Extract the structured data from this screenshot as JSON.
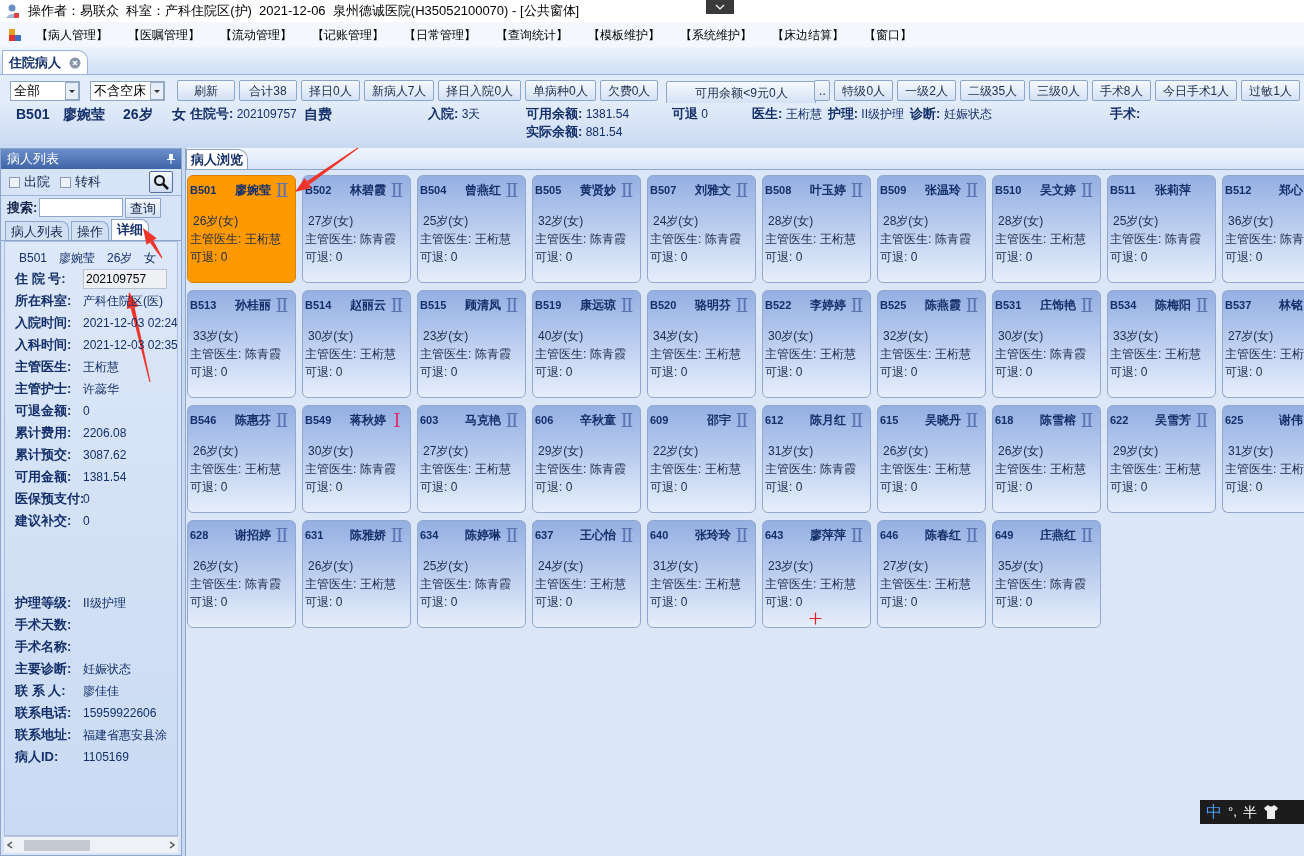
{
  "window": {
    "title": "操作者：易联众  科室：产科住院区(护)  2021-12-06  泉州德诚医院(H35052100070) - [公共窗体]"
  },
  "menu": [
    "【病人管理】",
    "【医嘱管理】",
    "【流动管理】",
    "【记账管理】",
    "【日常管理】",
    "【查询统计】",
    "【模板维护】",
    "【系统维护】",
    "【床边结算】",
    "【窗口】"
  ],
  "doc_tabs": [
    {
      "label": "住院病人",
      "selected": true
    }
  ],
  "toolbar": {
    "filters": [
      "全部",
      "不含空床"
    ],
    "buttons": [
      {
        "label": "刷新",
        "kind": "plain"
      },
      {
        "label": "合计38",
        "kind": "plain"
      },
      {
        "label": "择日0人",
        "kind": "plain"
      },
      {
        "label": "新病人7人",
        "kind": "plain"
      },
      {
        "label": "择日入院0人",
        "kind": "plain"
      },
      {
        "label": "单病种0人",
        "kind": "plain"
      },
      {
        "label": "欠费0人",
        "kind": "plain"
      },
      {
        "label": "可用余额<9元0人",
        "kind": "wide"
      },
      {
        "label": "..",
        "kind": "more"
      },
      {
        "label": "特级0人",
        "kind": "plain"
      },
      {
        "label": "一级2人",
        "kind": "plain"
      },
      {
        "label": "二级35人",
        "kind": "plain"
      },
      {
        "label": "三级0人",
        "kind": "plain"
      },
      {
        "label": "手术8人",
        "kind": "plain"
      },
      {
        "label": "今日手术1人",
        "kind": "plain"
      },
      {
        "label": "过敏1人",
        "kind": "plain"
      }
    ]
  },
  "summary": {
    "row_1": [
      {
        "kind": "big",
        "value": "B501"
      },
      {
        "kind": "big",
        "value": "廖婉莹"
      },
      {
        "kind": "big",
        "value": "26岁"
      },
      {
        "kind": "big",
        "value": "女"
      },
      {
        "kind": "field",
        "label": "住院号:",
        "value": "202109757"
      },
      {
        "kind": "big",
        "value": "自费"
      },
      {
        "kind": "field",
        "label": "入院:",
        "value": "3天"
      },
      {
        "kind": "field",
        "label": "可用余额:",
        "value": "1381.54"
      },
      {
        "kind": "field",
        "label": "可退",
        "value": "0"
      },
      {
        "kind": "field",
        "label": "医生:",
        "value": "王桁慧"
      },
      {
        "kind": "field",
        "label": "护理:",
        "value": "II级护理"
      },
      {
        "kind": "field",
        "label": "诊断:",
        "value": "妊娠状态"
      },
      {
        "kind": "field",
        "label": "手术:"
      }
    ],
    "row_2": [
      {
        "kind": "field",
        "label": "实际余额:",
        "value": "881.54"
      }
    ]
  },
  "sidebar": {
    "title": "病人列表",
    "checkboxes": [
      {
        "label": "出院",
        "checked": false
      },
      {
        "label": "转科",
        "checked": false
      }
    ],
    "search": {
      "label": "搜索:",
      "button": "查询"
    },
    "tabs": [
      {
        "label": "病人列表",
        "selected": false
      },
      {
        "label": "操作",
        "selected": false
      },
      {
        "label": "详细",
        "selected": true
      }
    ],
    "heading": [
      "B501",
      "廖婉莹",
      "26岁",
      "女"
    ],
    "sections": [
      [
        {
          "label": "住 院 号:",
          "value": "202109757",
          "kind": "input"
        },
        {
          "label": "所在科室:",
          "value": "产科住院区(医)"
        },
        {
          "label": "入院时间:",
          "value": "2021-12-03 02:24"
        },
        {
          "label": "入科时间:",
          "value": "2021-12-03 02:35"
        },
        {
          "label": "主管医生:",
          "value": "王桁慧"
        },
        {
          "label": "主管护士:",
          "value": "许蕊华"
        },
        {
          "label": "可退金额:",
          "value": "0"
        },
        {
          "label": "累计费用:",
          "value": "2206.08"
        },
        {
          "label": "累计预交:",
          "value": "3087.62"
        },
        {
          "label": "可用金额:",
          "value": "1381.54"
        },
        {
          "label": "医保预支付:",
          "value": "0"
        },
        {
          "label": "建议补交:",
          "value": "0"
        }
      ],
      [
        {
          "label": "护理等级:",
          "value": "II级护理"
        },
        {
          "label": "手术天数:"
        },
        {
          "label": "手术名称:"
        },
        {
          "label": "主要诊断:",
          "value": "妊娠状态"
        },
        {
          "label": "联 系 人:",
          "value": "廖佳佳"
        },
        {
          "label": "联系电话:",
          "value": "15959922606"
        },
        {
          "label": "联系地址:",
          "value": "福建省惠安县涂"
        },
        {
          "label": "病人ID:",
          "value": "1105169"
        }
      ]
    ]
  },
  "browser": {
    "tab": "病人浏览",
    "cards": [
      {
        "bed": "B501",
        "name": "廖婉莹",
        "grade": "Ⅱ",
        "color": "#5a74b4",
        "age": "26岁(女)",
        "doctor": "主管医生: 王桁慧",
        "refund": "可退: 0",
        "selected": true
      },
      {
        "bed": "B502",
        "name": "林碧霞",
        "grade": "Ⅱ",
        "color": "#5a74b4",
        "age": "27岁(女)",
        "doctor": "主管医生: 陈青霞",
        "refund": "可退: 0",
        "selected": false
      },
      {
        "bed": "B504",
        "name": "曾燕红",
        "grade": "Ⅱ",
        "color": "#5a74b4",
        "age": "25岁(女)",
        "doctor": "主管医生: 王桁慧",
        "refund": "可退: 0",
        "selected": false
      },
      {
        "bed": "B505",
        "name": "黄贤妙",
        "grade": "Ⅱ",
        "color": "#5a74b4",
        "age": "32岁(女)",
        "doctor": "主管医生: 陈青霞",
        "refund": "可退: 0",
        "selected": false
      },
      {
        "bed": "B507",
        "name": "刘雅文",
        "grade": "Ⅱ",
        "color": "#5a74b4",
        "age": "24岁(女)",
        "doctor": "主管医生: 陈青霞",
        "refund": "可退: 0",
        "selected": false
      },
      {
        "bed": "B508",
        "name": "叶玉婷",
        "grade": "Ⅱ",
        "color": "#5a74b4",
        "age": "28岁(女)",
        "doctor": "主管医生: 王桁慧",
        "refund": "可退: 0",
        "selected": false
      },
      {
        "bed": "B509",
        "name": "张温玲",
        "grade": "Ⅱ",
        "color": "#5a74b4",
        "age": "28岁(女)",
        "doctor": "主管医生: 陈青霞",
        "refund": "可退: 0",
        "selected": false
      },
      {
        "bed": "B510",
        "name": "吴文婷",
        "grade": "Ⅱ",
        "color": "#5a74b4",
        "age": "28岁(女)",
        "doctor": "主管医生: 王桁慧",
        "refund": "可退: 0",
        "selected": false
      },
      {
        "bed": "B511",
        "name": "张莉萍",
        "age": "25岁(女)",
        "doctor": "主管医生: 陈青霞",
        "refund": "可退: 0",
        "selected": false
      },
      {
        "bed": "B512",
        "name": "郑心",
        "age": "36岁(女)",
        "doctor": "主管医生: 陈青",
        "refund": "可退: 0",
        "selected": false
      },
      {
        "bed": "B513",
        "name": "孙桂丽",
        "grade": "Ⅱ",
        "color": "#5a74b4",
        "age": "33岁(女)",
        "doctor": "主管医生: 陈青霞",
        "refund": "可退: 0",
        "selected": false
      },
      {
        "bed": "B514",
        "name": "赵丽云",
        "grade": "Ⅱ",
        "color": "#5a74b4",
        "age": "30岁(女)",
        "doctor": "主管医生: 王桁慧",
        "refund": "可退: 0",
        "selected": false
      },
      {
        "bed": "B515",
        "name": "顾清凤",
        "grade": "Ⅱ",
        "color": "#5a74b4",
        "age": "23岁(女)",
        "doctor": "主管医生: 陈青霞",
        "refund": "可退: 0",
        "selected": false
      },
      {
        "bed": "B519",
        "name": "康远琼",
        "grade": "Ⅱ",
        "color": "#5a74b4",
        "age": "40岁(女)",
        "doctor": "主管医生: 陈青霞",
        "refund": "可退: 0",
        "selected": false
      },
      {
        "bed": "B520",
        "name": "骆明芬",
        "grade": "Ⅱ",
        "color": "#5a74b4",
        "age": "34岁(女)",
        "doctor": "主管医生: 王桁慧",
        "refund": "可退: 0",
        "selected": false
      },
      {
        "bed": "B522",
        "name": "李婷婷",
        "grade": "Ⅱ",
        "color": "#5a74b4",
        "age": "30岁(女)",
        "doctor": "主管医生: 王桁慧",
        "refund": "可退: 0",
        "selected": false
      },
      {
        "bed": "B525",
        "name": "陈燕霞",
        "grade": "Ⅱ",
        "color": "#5a74b4",
        "age": "32岁(女)",
        "doctor": "主管医生: 王桁慧",
        "refund": "可退: 0",
        "selected": false
      },
      {
        "bed": "B531",
        "name": "庄饰艳",
        "grade": "Ⅱ",
        "color": "#5a74b4",
        "age": "30岁(女)",
        "doctor": "主管医生: 陈青霞",
        "refund": "可退: 0",
        "selected": false
      },
      {
        "bed": "B534",
        "name": "陈梅阳",
        "grade": "Ⅱ",
        "color": "#5a74b4",
        "age": "33岁(女)",
        "doctor": "主管医生: 王桁慧",
        "refund": "可退: 0",
        "selected": false
      },
      {
        "bed": "B537",
        "name": "林铭",
        "age": "27岁(女)",
        "doctor": "主管医生: 王桁",
        "refund": "可退: 0",
        "selected": false
      },
      {
        "bed": "B546",
        "name": "陈惠芬",
        "grade": "Ⅱ",
        "color": "#5a74b4",
        "age": "26岁(女)",
        "doctor": "主管医生: 王桁慧",
        "refund": "可退: 0",
        "selected": false
      },
      {
        "bed": "B549",
        "name": "蒋秋婷",
        "grade": "Ⅰ",
        "color": "#e0306f",
        "age": "30岁(女)",
        "doctor": "主管医生: 陈青霞",
        "refund": "可退: 0",
        "selected": false
      },
      {
        "bed": "603",
        "name": "马克艳",
        "grade": "Ⅱ",
        "color": "#5a74b4",
        "age": "27岁(女)",
        "doctor": "主管医生: 王桁慧",
        "refund": "可退: 0",
        "selected": false
      },
      {
        "bed": "606",
        "name": "辛秋童",
        "grade": "Ⅱ",
        "color": "#5a74b4",
        "age": "29岁(女)",
        "doctor": "主管医生: 陈青霞",
        "refund": "可退: 0",
        "selected": false
      },
      {
        "bed": "609",
        "name": "邵宇",
        "grade": "Ⅱ",
        "color": "#5a74b4",
        "age": "22岁(女)",
        "doctor": "主管医生: 王桁慧",
        "refund": "可退: 0",
        "selected": false
      },
      {
        "bed": "612",
        "name": "陈月红",
        "grade": "Ⅱ",
        "color": "#5a74b4",
        "age": "31岁(女)",
        "doctor": "主管医生: 陈青霞",
        "refund": "可退: 0",
        "selected": false
      },
      {
        "bed": "615",
        "name": "吴晓丹",
        "grade": "Ⅱ",
        "color": "#5a74b4",
        "age": "26岁(女)",
        "doctor": "主管医生: 王桁慧",
        "refund": "可退: 0",
        "selected": false
      },
      {
        "bed": "618",
        "name": "陈雪榕",
        "grade": "Ⅱ",
        "color": "#5a74b4",
        "age": "26岁(女)",
        "doctor": "主管医生: 王桁慧",
        "refund": "可退: 0",
        "selected": false
      },
      {
        "bed": "622",
        "name": "吴雪芳",
        "grade": "Ⅱ",
        "color": "#5a74b4",
        "age": "29岁(女)",
        "doctor": "主管医生: 王桁慧",
        "refund": "可退: 0",
        "selected": false
      },
      {
        "bed": "625",
        "name": "谢伟",
        "age": "31岁(女)",
        "doctor": "主管医生: 王桁",
        "refund": "可退: 0",
        "selected": false
      },
      {
        "bed": "628",
        "name": "谢招婷",
        "grade": "Ⅱ",
        "color": "#5a74b4",
        "age": "26岁(女)",
        "doctor": "主管医生: 陈青霞",
        "refund": "可退: 0",
        "selected": false
      },
      {
        "bed": "631",
        "name": "陈雅娇",
        "grade": "Ⅱ",
        "color": "#5a74b4",
        "age": "26岁(女)",
        "doctor": "主管医生: 王桁慧",
        "refund": "可退: 0",
        "selected": false
      },
      {
        "bed": "634",
        "name": "陈婷琳",
        "grade": "Ⅱ",
        "color": "#5a74b4",
        "age": "25岁(女)",
        "doctor": "主管医生: 陈青霞",
        "refund": "可退: 0",
        "selected": false
      },
      {
        "bed": "637",
        "name": "王心怡",
        "grade": "Ⅱ",
        "color": "#5a74b4",
        "age": "24岁(女)",
        "doctor": "主管医生: 王桁慧",
        "refund": "可退: 0",
        "selected": false
      },
      {
        "bed": "640",
        "name": "张玲玲",
        "grade": "Ⅱ",
        "color": "#5a74b4",
        "age": "31岁(女)",
        "doctor": "主管医生: 王桁慧",
        "refund": "可退: 0",
        "selected": false
      },
      {
        "bed": "643",
        "name": "廖萍萍",
        "grade": "Ⅱ",
        "color": "#5a74b4",
        "age": "23岁(女)",
        "doctor": "主管医生: 王桁慧",
        "refund": "可退: 0",
        "selected": false
      },
      {
        "bed": "646",
        "name": "陈春红",
        "grade": "Ⅱ",
        "color": "#5a74b4",
        "age": "27岁(女)",
        "doctor": "主管医生: 王桁慧",
        "refund": "可退: 0",
        "selected": false
      },
      {
        "bed": "649",
        "name": "庄燕红",
        "grade": "Ⅱ",
        "color": "#5a74b4",
        "age": "35岁(女)",
        "doctor": "主管医生: 陈青霞",
        "refund": "可退: 0",
        "selected": false
      }
    ]
  },
  "ime": {
    "mode": "中",
    "punct": "°,",
    "width": "半"
  }
}
